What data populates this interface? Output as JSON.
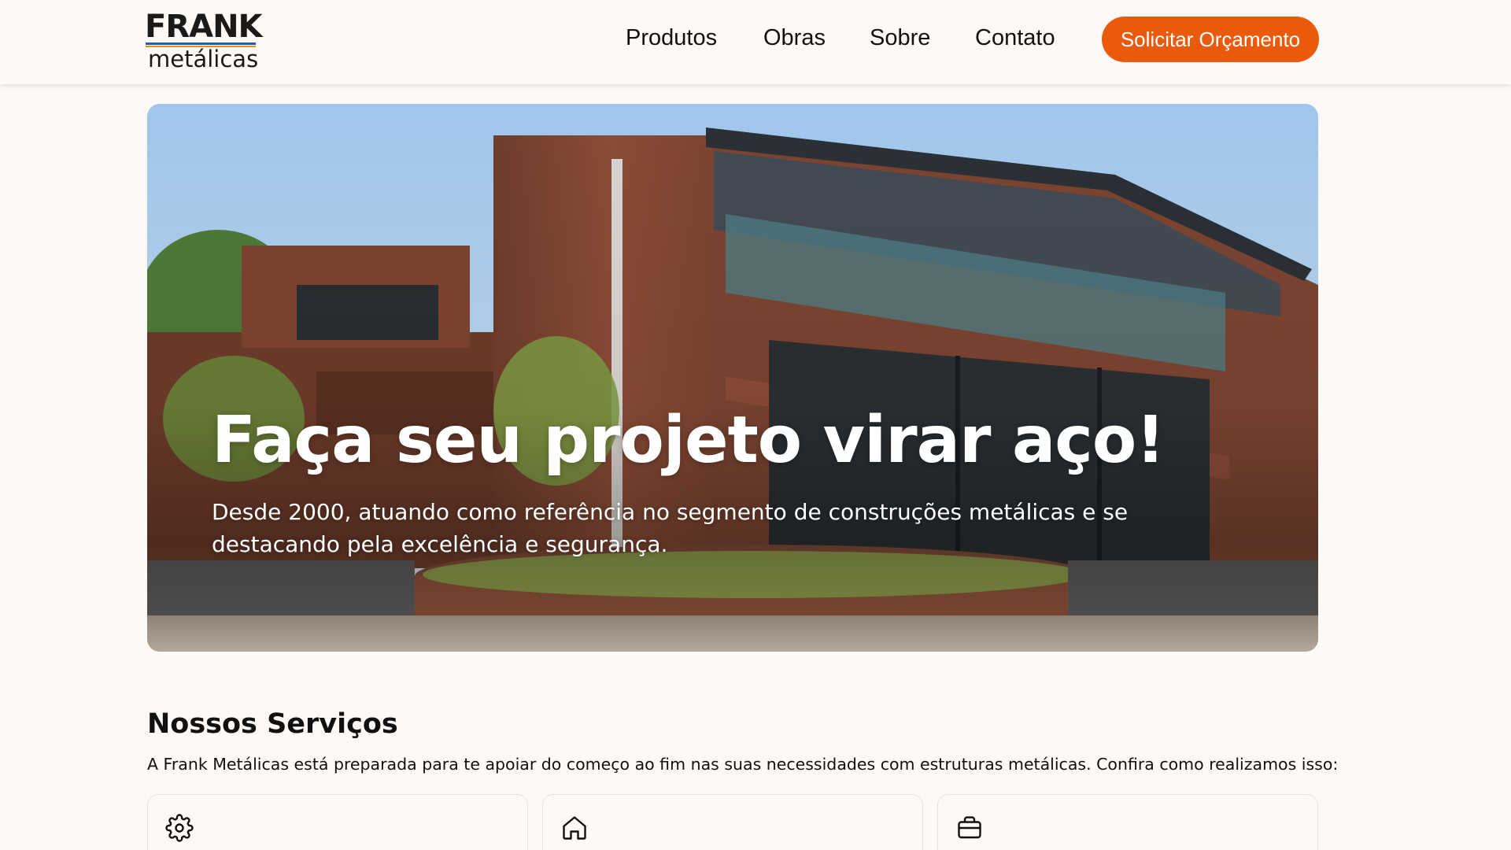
{
  "brand": {
    "name": "FRANK",
    "sub": "metálicas"
  },
  "nav": {
    "items": [
      {
        "label": "Produtos"
      },
      {
        "label": "Obras"
      },
      {
        "label": "Sobre"
      },
      {
        "label": "Contato"
      }
    ],
    "cta_label": "Solicitar Orçamento"
  },
  "hero": {
    "title": "Faça seu projeto virar aço!",
    "subtitle": "Desde 2000, atuando como referência no segmento de construções metálicas e se destacando pela excelência e segurança."
  },
  "services": {
    "title": "Nossos Serviços",
    "description": "A Frank Metálicas está preparada para te apoiar do começo ao fim nas suas necessidades com estruturas metálicas. Confira como realizamos isso:",
    "cards": [
      {
        "icon": "gear-icon"
      },
      {
        "icon": "home-icon"
      },
      {
        "icon": "briefcase-icon"
      }
    ]
  },
  "colors": {
    "accent": "#ea5a0c",
    "logo_blue": "#1e5fa8",
    "logo_orange": "#f08a1c",
    "background": "#fdf9f7"
  }
}
